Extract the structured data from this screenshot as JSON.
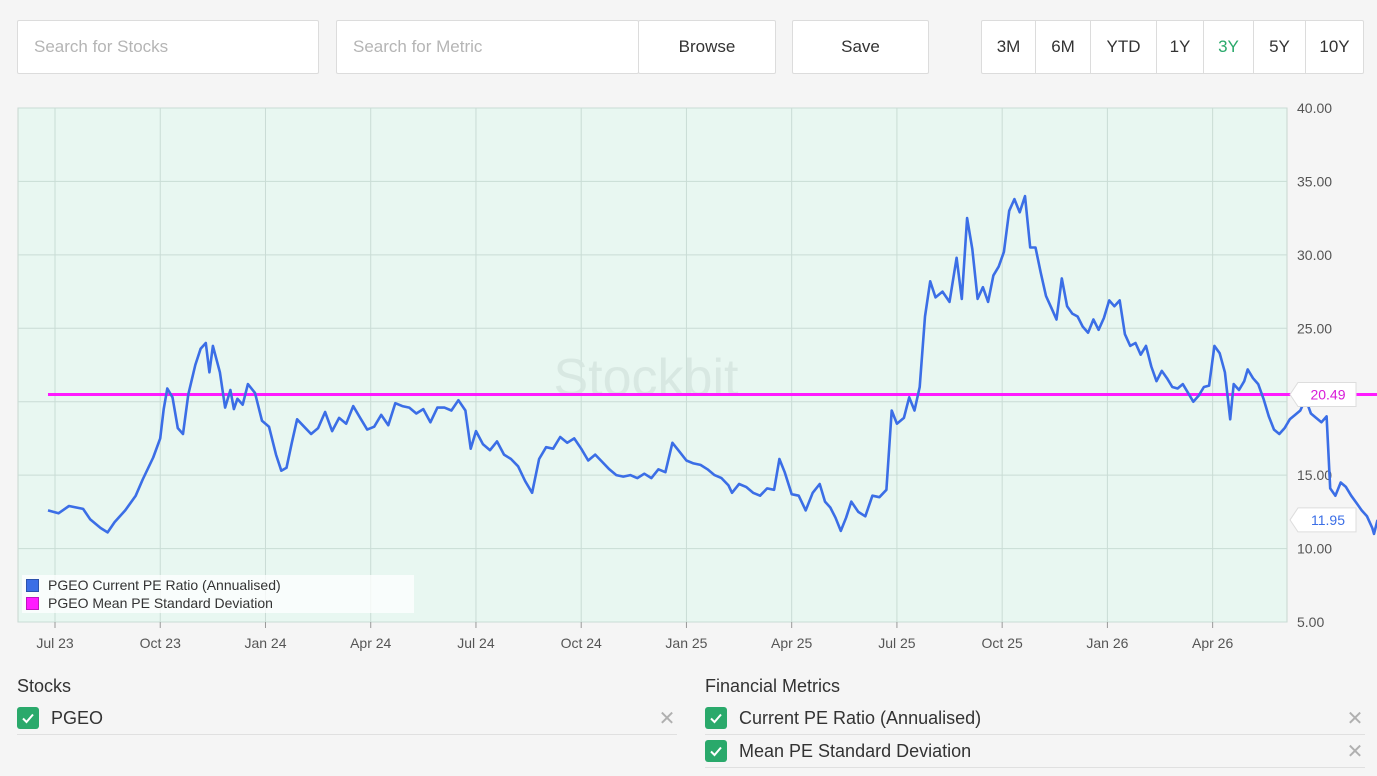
{
  "toolbar": {
    "search_stocks_placeholder": "Search for Stocks",
    "search_metric_placeholder": "Search for Metric",
    "browse_label": "Browse",
    "save_label": "Save"
  },
  "time_ranges": [
    {
      "label": "3M",
      "active": false
    },
    {
      "label": "6M",
      "active": false
    },
    {
      "label": "YTD",
      "active": false
    },
    {
      "label": "1Y",
      "active": false
    },
    {
      "label": "3Y",
      "active": true
    },
    {
      "label": "5Y",
      "active": false
    },
    {
      "label": "10Y",
      "active": false
    }
  ],
  "colors": {
    "accent": "#2aa96b",
    "pe_series": "#3b6ee6",
    "mean_series": "#ff1aff",
    "plot_bg": "#e8f7f1",
    "grid": "#c9dcd5"
  },
  "icons": {
    "checkbox": "check-icon",
    "remove": "close-icon"
  },
  "chart_data": {
    "type": "line",
    "watermark": "Stockbit",
    "x_ticks": [
      "Jul 23",
      "Oct 23",
      "Jan 24",
      "Apr 24",
      "Jul 24",
      "Oct 24",
      "Jan 25",
      "Apr 25",
      "Jul 25",
      "Oct 25",
      "Jan 26",
      "Apr 26"
    ],
    "y_ticks": [
      "40.00",
      "35.00",
      "30.00",
      "25.00",
      "20.00",
      "15.00",
      "10.00",
      "5.00"
    ],
    "ylim": [
      5,
      40
    ],
    "x_start_month_offset": -0.35,
    "x_end_month": 35.75,
    "grid": true,
    "legend_position": "bottom-left",
    "series": [
      {
        "name": "PGEO Current PE Ratio (Annualised)",
        "color": "#3b6ee6",
        "last_value_label": "11.95",
        "points": [
          [
            -0.2,
            12.6
          ],
          [
            0.1,
            12.4
          ],
          [
            0.4,
            12.9
          ],
          [
            0.8,
            12.7
          ],
          [
            1.0,
            12.0
          ],
          [
            1.3,
            11.4
          ],
          [
            1.5,
            11.1
          ],
          [
            1.7,
            11.8
          ],
          [
            2.0,
            12.6
          ],
          [
            2.3,
            13.6
          ],
          [
            2.5,
            14.7
          ],
          [
            2.8,
            16.2
          ],
          [
            3.0,
            17.5
          ],
          [
            3.1,
            19.5
          ],
          [
            3.2,
            20.9
          ],
          [
            3.35,
            20.3
          ],
          [
            3.5,
            18.2
          ],
          [
            3.65,
            17.8
          ],
          [
            3.8,
            20.5
          ],
          [
            4.0,
            22.5
          ],
          [
            4.15,
            23.6
          ],
          [
            4.3,
            24.0
          ],
          [
            4.4,
            22.0
          ],
          [
            4.5,
            23.8
          ],
          [
            4.7,
            22.0
          ],
          [
            4.85,
            19.6
          ],
          [
            5.0,
            20.8
          ],
          [
            5.1,
            19.5
          ],
          [
            5.2,
            20.2
          ],
          [
            5.35,
            19.8
          ],
          [
            5.5,
            21.2
          ],
          [
            5.7,
            20.6
          ],
          [
            5.9,
            18.7
          ],
          [
            6.1,
            18.3
          ],
          [
            6.3,
            16.4
          ],
          [
            6.45,
            15.3
          ],
          [
            6.6,
            15.5
          ],
          [
            6.75,
            17.2
          ],
          [
            6.9,
            18.8
          ],
          [
            7.1,
            18.3
          ],
          [
            7.3,
            17.8
          ],
          [
            7.5,
            18.2
          ],
          [
            7.7,
            19.3
          ],
          [
            7.9,
            18.0
          ],
          [
            8.1,
            18.9
          ],
          [
            8.3,
            18.5
          ],
          [
            8.5,
            19.7
          ],
          [
            8.7,
            18.9
          ],
          [
            8.9,
            18.1
          ],
          [
            9.1,
            18.3
          ],
          [
            9.3,
            19.1
          ],
          [
            9.5,
            18.4
          ],
          [
            9.7,
            19.9
          ],
          [
            9.9,
            19.7
          ],
          [
            10.1,
            19.6
          ],
          [
            10.3,
            19.2
          ],
          [
            10.5,
            19.5
          ],
          [
            10.7,
            18.6
          ],
          [
            10.9,
            19.6
          ],
          [
            11.1,
            19.6
          ],
          [
            11.3,
            19.4
          ],
          [
            11.5,
            20.1
          ],
          [
            11.7,
            19.4
          ],
          [
            11.85,
            16.8
          ],
          [
            12.0,
            18.0
          ],
          [
            12.2,
            17.1
          ],
          [
            12.4,
            16.7
          ],
          [
            12.6,
            17.3
          ],
          [
            12.8,
            16.4
          ],
          [
            13.0,
            16.1
          ],
          [
            13.2,
            15.6
          ],
          [
            13.4,
            14.6
          ],
          [
            13.6,
            13.8
          ],
          [
            13.8,
            16.1
          ],
          [
            14.0,
            16.9
          ],
          [
            14.2,
            16.8
          ],
          [
            14.4,
            17.6
          ],
          [
            14.6,
            17.2
          ],
          [
            14.8,
            17.5
          ],
          [
            15.0,
            16.8
          ],
          [
            15.2,
            16.0
          ],
          [
            15.4,
            16.4
          ],
          [
            15.6,
            15.9
          ],
          [
            15.8,
            15.4
          ],
          [
            16.0,
            15.0
          ],
          [
            16.2,
            14.9
          ],
          [
            16.4,
            15.0
          ],
          [
            16.6,
            14.8
          ],
          [
            16.8,
            15.1
          ],
          [
            17.0,
            14.8
          ],
          [
            17.2,
            15.4
          ],
          [
            17.4,
            15.2
          ],
          [
            17.6,
            17.2
          ],
          [
            17.8,
            16.6
          ],
          [
            18.0,
            16.0
          ],
          [
            18.2,
            15.8
          ],
          [
            18.4,
            15.7
          ],
          [
            18.6,
            15.4
          ],
          [
            18.8,
            15.0
          ],
          [
            19.0,
            14.8
          ],
          [
            19.2,
            14.3
          ],
          [
            19.3,
            13.8
          ],
          [
            19.5,
            14.4
          ],
          [
            19.7,
            14.2
          ],
          [
            19.9,
            13.8
          ],
          [
            20.1,
            13.6
          ],
          [
            20.3,
            14.1
          ],
          [
            20.5,
            14.0
          ],
          [
            20.65,
            16.1
          ],
          [
            20.8,
            15.2
          ],
          [
            21.0,
            13.7
          ],
          [
            21.2,
            13.6
          ],
          [
            21.4,
            12.6
          ],
          [
            21.6,
            13.8
          ],
          [
            21.8,
            14.4
          ],
          [
            21.95,
            13.2
          ],
          [
            22.1,
            12.8
          ],
          [
            22.25,
            12.1
          ],
          [
            22.4,
            11.2
          ],
          [
            22.55,
            12.1
          ],
          [
            22.7,
            13.2
          ],
          [
            22.9,
            12.5
          ],
          [
            23.1,
            12.2
          ],
          [
            23.3,
            13.6
          ],
          [
            23.5,
            13.5
          ],
          [
            23.7,
            14.0
          ],
          [
            23.85,
            19.4
          ],
          [
            24.0,
            18.5
          ],
          [
            24.2,
            18.9
          ],
          [
            24.35,
            20.3
          ],
          [
            24.5,
            19.4
          ],
          [
            24.65,
            21.0
          ],
          [
            24.8,
            25.8
          ],
          [
            24.95,
            28.2
          ],
          [
            25.1,
            27.1
          ],
          [
            25.3,
            27.5
          ],
          [
            25.5,
            26.8
          ],
          [
            25.7,
            29.8
          ],
          [
            25.85,
            27.0
          ],
          [
            26.0,
            32.5
          ],
          [
            26.15,
            30.4
          ],
          [
            26.3,
            27.0
          ],
          [
            26.45,
            27.8
          ],
          [
            26.6,
            26.8
          ],
          [
            26.75,
            28.6
          ],
          [
            26.9,
            29.2
          ],
          [
            27.05,
            30.2
          ],
          [
            27.2,
            33.0
          ],
          [
            27.35,
            33.8
          ],
          [
            27.5,
            32.9
          ],
          [
            27.65,
            34.0
          ],
          [
            27.8,
            30.5
          ],
          [
            27.95,
            30.5
          ],
          [
            28.1,
            28.8
          ],
          [
            28.25,
            27.2
          ],
          [
            28.4,
            26.4
          ],
          [
            28.55,
            25.6
          ],
          [
            28.7,
            28.4
          ],
          [
            28.85,
            26.5
          ],
          [
            29.0,
            26.0
          ],
          [
            29.15,
            25.8
          ],
          [
            29.3,
            25.1
          ],
          [
            29.45,
            24.7
          ],
          [
            29.6,
            25.6
          ],
          [
            29.75,
            24.9
          ],
          [
            29.9,
            25.7
          ],
          [
            30.05,
            26.9
          ],
          [
            30.2,
            26.5
          ],
          [
            30.35,
            26.9
          ],
          [
            30.5,
            24.6
          ],
          [
            30.65,
            23.8
          ],
          [
            30.8,
            24.0
          ],
          [
            30.95,
            23.2
          ],
          [
            31.1,
            23.8
          ],
          [
            31.25,
            22.4
          ],
          [
            31.4,
            21.4
          ],
          [
            31.55,
            22.1
          ],
          [
            31.7,
            21.6
          ],
          [
            31.85,
            21.0
          ],
          [
            32.0,
            20.9
          ],
          [
            32.15,
            21.2
          ],
          [
            32.3,
            20.6
          ],
          [
            32.45,
            20.0
          ],
          [
            32.6,
            20.4
          ],
          [
            32.75,
            21.0
          ],
          [
            32.9,
            21.1
          ],
          [
            33.05,
            23.8
          ],
          [
            33.2,
            23.3
          ],
          [
            33.35,
            22.0
          ],
          [
            33.5,
            18.8
          ],
          [
            33.6,
            21.2
          ],
          [
            33.75,
            20.8
          ],
          [
            33.9,
            21.4
          ],
          [
            34.0,
            22.2
          ],
          [
            34.15,
            21.6
          ],
          [
            34.3,
            21.2
          ],
          [
            34.45,
            20.2
          ],
          [
            34.6,
            19.0
          ],
          [
            34.75,
            18.1
          ],
          [
            34.9,
            17.8
          ],
          [
            35.05,
            18.2
          ],
          [
            35.2,
            18.8
          ],
          [
            35.35,
            19.1
          ],
          [
            35.5,
            19.4
          ],
          [
            35.65,
            20.2
          ],
          [
            35.8,
            19.2
          ],
          [
            35.95,
            18.9
          ],
          [
            36.1,
            18.6
          ],
          [
            36.25,
            19.0
          ],
          [
            36.35,
            14.1
          ],
          [
            36.5,
            13.6
          ],
          [
            36.65,
            14.5
          ],
          [
            36.8,
            14.2
          ],
          [
            36.95,
            13.6
          ],
          [
            37.1,
            13.1
          ],
          [
            37.25,
            12.6
          ],
          [
            37.4,
            12.2
          ],
          [
            37.55,
            11.4
          ],
          [
            37.6,
            11.0
          ],
          [
            37.7,
            11.95
          ]
        ]
      },
      {
        "name": "PGEO Mean PE Standard Deviation",
        "color": "#ff1aff",
        "last_value_label": "20.49",
        "constant_value": 20.49,
        "x_range": [
          -0.2,
          37.7
        ]
      }
    ]
  },
  "stocks_panel": {
    "title": "Stocks",
    "items": [
      {
        "label": "PGEO",
        "checked": true
      }
    ]
  },
  "metrics_panel": {
    "title": "Financial Metrics",
    "items": [
      {
        "label": "Current PE Ratio (Annualised)",
        "checked": true
      },
      {
        "label": "Mean PE Standard Deviation",
        "checked": true
      }
    ]
  }
}
